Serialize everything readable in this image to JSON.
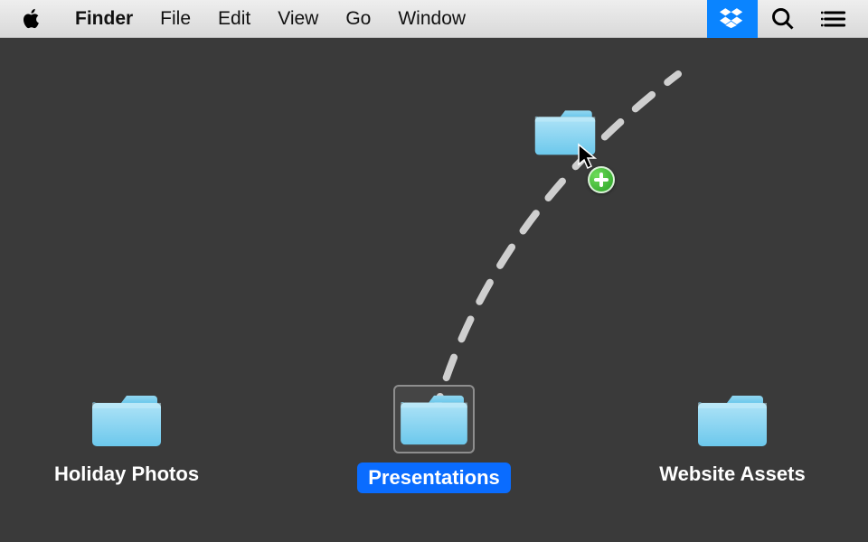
{
  "menubar": {
    "app": "Finder",
    "items": [
      "File",
      "Edit",
      "View",
      "Go",
      "Window"
    ]
  },
  "desktop": {
    "folders": [
      {
        "label": "Holiday Photos"
      },
      {
        "label": "Presentations"
      },
      {
        "label": "Website Assets"
      }
    ]
  },
  "colors": {
    "menubar_highlight": "#0a84ff",
    "selection_blue": "#0a6cff",
    "folder_blue_light": "#9fdcf5",
    "folder_blue_dark": "#5cc1e8",
    "plus_green": "#2aa126"
  }
}
